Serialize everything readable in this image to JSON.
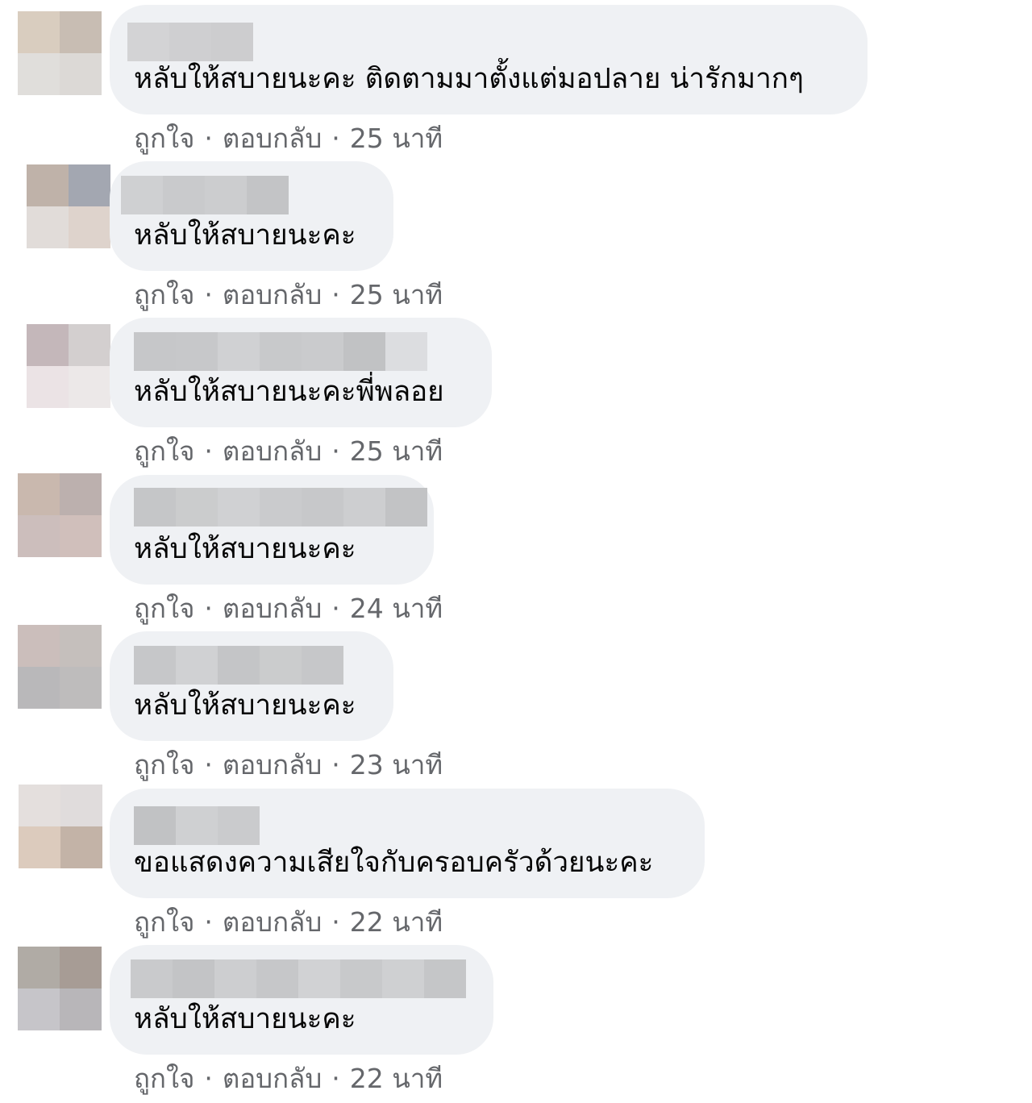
{
  "actions": {
    "like_label": "ถูกใจ",
    "reply_label": "ตอบกลับ",
    "separator": "·"
  },
  "comments": [
    {
      "text": "หลับให้สบายนะคะ ติดตามมาตั้งแต่มอปลาย น่ารักมากๆ",
      "time": "25 นาที",
      "avatar_colors": [
        "#d9cdbf",
        "#c8bdb3",
        "#e0dedb",
        "#dcd9d6"
      ],
      "name_blur_colors": [
        "#d3d3d5",
        "#cfcfd1",
        "#cdcdcf"
      ]
    },
    {
      "text": "หลับให้สบายนะคะ",
      "time": "25 นาที",
      "avatar_colors": [
        "#bfb2a9",
        "#a3a7b1",
        "#e1dcd9",
        "#ded3cc"
      ],
      "name_blur_colors": [
        "#cfd0d2",
        "#c9cacc",
        "#cccdcf",
        "#c3c4c6"
      ]
    },
    {
      "text": "หลับให้สบายนะคะพี่พลอย",
      "time": "25 นาที",
      "avatar_colors": [
        "#c4b7ba",
        "#d3cfcf",
        "#ebe3e5",
        "#ece8e8"
      ],
      "name_blur_colors": [
        "#c6c7c9",
        "#c7c8ca",
        "#d0d1d3",
        "#c8c9cb",
        "#cacbcd",
        "#c1c2c4",
        "#dcdde0"
      ]
    },
    {
      "text": "หลับให้สบายนะคะ",
      "time": "24 นาที",
      "avatar_colors": [
        "#c9b8ae",
        "#bcb0ae",
        "#ccbebc",
        "#d0bfbb"
      ],
      "name_blur_colors": [
        "#c5c6c8",
        "#cbcccd",
        "#d0d1d3",
        "#cacbcd",
        "#c7c8ca",
        "#cdced0",
        "#c2c3c5"
      ]
    },
    {
      "text": "หลับให้สบายนะคะ",
      "time": "23 นาที",
      "avatar_colors": [
        "#cbbebb",
        "#c5bfbc",
        "#b9b8ba",
        "#bebcbc"
      ],
      "name_blur_colors": [
        "#c6c7c9",
        "#d0d1d3",
        "#c4c5c7",
        "#cbcccd",
        "#c6c7c9"
      ]
    },
    {
      "text": "ขอแสดงความเสียใจกับครอบครัวด้วยนะคะ",
      "time": "22 นาที",
      "avatar_colors": [
        "#e4dfdd",
        "#e0dcdc",
        "#dccbbd",
        "#c3b3a7"
      ],
      "name_blur_colors": [
        "#c1c2c4",
        "#cfd0d2",
        "#cacbcd"
      ]
    },
    {
      "text": "หลับให้สบายนะคะ",
      "time": "22 นาที",
      "avatar_colors": [
        "#b0aba5",
        "#a79c95",
        "#c6c5c9",
        "#b8b6b9"
      ],
      "name_blur_colors": [
        "#c9cacc",
        "#c3c4c6",
        "#cdced0",
        "#c6c7c9",
        "#d1d2d4",
        "#c8c9cb",
        "#cfd0d2",
        "#c5c6c8"
      ]
    }
  ]
}
